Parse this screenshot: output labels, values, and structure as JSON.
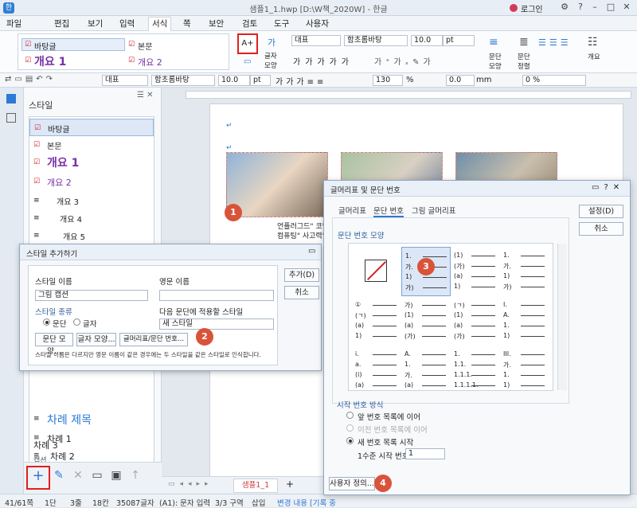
{
  "window": {
    "title": "샘플1_1.hwp [D:\\W책_2020W] - 한글",
    "app_icon": "한",
    "login": "로그인"
  },
  "menu": [
    "파일",
    "편집",
    "보기",
    "입력",
    "서식",
    "쪽",
    "보안",
    "검토",
    "도구",
    "사용자"
  ],
  "ribbon": {
    "styles": [
      "바탕글",
      "본문",
      "개요 1",
      "개요 2"
    ],
    "add_style_tooltip": "스타일 추가",
    "char_shape": "글자 모양",
    "style_select": "대표",
    "font_select": "함초롬바탕",
    "size_select": "10.0",
    "unit": "pt",
    "para_shape": "문단 모양",
    "para_align": "문단 정렬",
    "outline": "개요"
  },
  "toolbar2": {
    "style": "대표",
    "font": "함초롬바탕",
    "size": "10.0",
    "unit": "pt",
    "line_spacing": "130",
    "pct": "%",
    "indent": "0.0",
    "mm": "mm",
    "zoom_pct": "0 %"
  },
  "style_panel": {
    "title": "스타일",
    "items": [
      "바탕글",
      "본문",
      "개요 1",
      "개요 2",
      "개요 3",
      "개요 4",
      "개요 5"
    ],
    "lower_items": [
      "차례 제목",
      "차례 1",
      "차례 2",
      "차례 3",
      "캡션"
    ]
  },
  "document": {
    "caption_line1": "언플러그드\" 코딩\" 수업:",
    "caption_line2": "컴퓨팅\" 사고력\" 키우기.",
    "tab_name": "샘플1_1"
  },
  "add_style_dialog": {
    "title": "스타일 추가하기",
    "name_label": "스타일 이름",
    "name_value": "그림 캡션",
    "eng_label": "영문 이름",
    "type_label": "스타일 종류",
    "type_para": "문단",
    "type_char": "글자",
    "next_label": "다음 문단에 적용할 스타일",
    "next_value": "새 스타일",
    "btn_para": "문단 모양...",
    "btn_char": "글자 모양...",
    "btn_bullet": "글머리표/문단 번호...",
    "note": "스타일 이름은 다르지만 영문 이름이 같은 경우에는 두 스타일을 같은 스타일로 인식합니다.",
    "add_btn": "추가(D)",
    "cancel_btn": "취소"
  },
  "bullet_dialog": {
    "title": "글머리표 및 문단 번호",
    "tabs": [
      "글머리표",
      "문단 번호",
      "그림 글머리표"
    ],
    "group": "문단 번호 모양",
    "set_btn": "설정(D)",
    "cancel_btn": "취소",
    "start_group": "시작 번호 방식",
    "opt1": "앞 번호 목록에 이어",
    "opt2": "이전 번호 목록에 이어",
    "opt3": "새 번호 목록 시작",
    "level_label": "1수준 시작 번호",
    "level_value": "1",
    "custom_btn": "사용자 정의...",
    "cells": [
      [
        "1.",
        "가.",
        "1)",
        "가)"
      ],
      [
        "(1)",
        "(가)",
        "(a)",
        "1)"
      ],
      [
        "1.",
        "가.",
        "1)",
        "가)"
      ],
      [
        "①",
        "(ㄱ)",
        "(a)",
        "1)"
      ],
      [
        "가)",
        "(1)",
        "(a)",
        "(가)"
      ],
      [
        "(ㄱ)",
        "(1)",
        "(a)",
        "(가)"
      ],
      [
        "I.",
        "A.",
        "1.",
        "1)"
      ],
      [
        "i.",
        "a.",
        "(i)",
        "(a)"
      ],
      [
        "A.",
        "1.",
        "가.",
        "(a)"
      ],
      [
        "1.",
        "1.1.",
        "1.1.1.",
        "1.1.1.1."
      ],
      [
        "III.",
        "가.",
        "1.",
        "1)"
      ]
    ]
  },
  "badges": [
    "1",
    "2",
    "3",
    "4"
  ],
  "status": {
    "page": "41/61쪽",
    "col": "1단",
    "line": "3줄",
    "chars": "18칸",
    "total": "35087글자",
    "mode": "(A1): 문자 입력",
    "section": "3/3 구역",
    "insert": "삽입",
    "track": "변경 내용 [기록 중"
  }
}
